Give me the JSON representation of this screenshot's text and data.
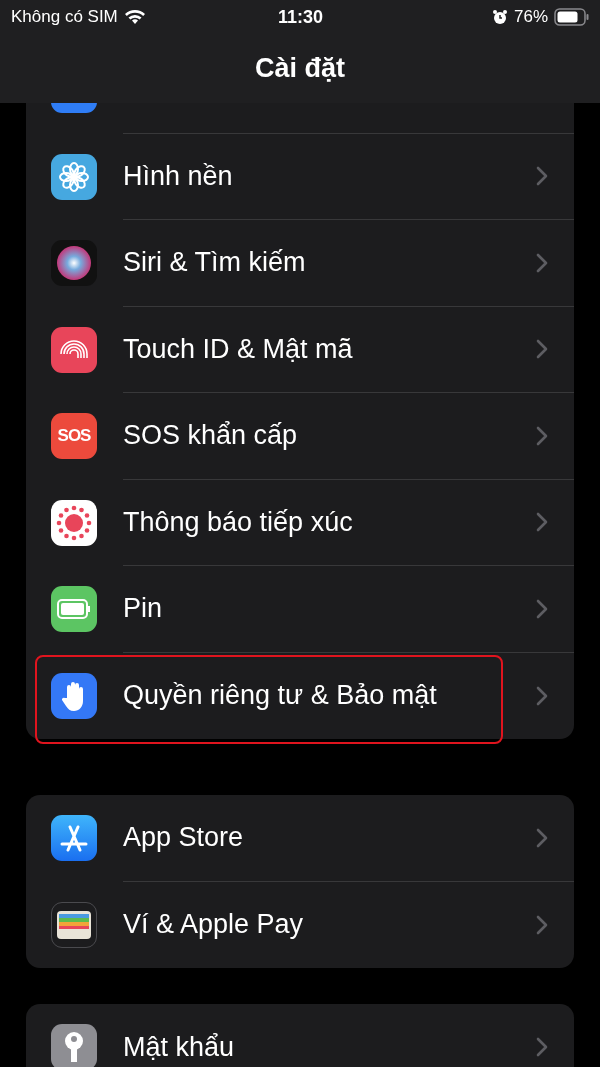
{
  "status_bar": {
    "carrier": "Không có SIM",
    "time": "11:30",
    "battery": "76%"
  },
  "title": "Cài đặt",
  "groups": [
    {
      "rows": [
        {
          "kind": "accessibility",
          "highlighted": false
        },
        {
          "kind": "wallpaper",
          "label": "Hình nền",
          "highlighted": false
        },
        {
          "kind": "siri",
          "label": "Siri & Tìm kiếm",
          "highlighted": false
        },
        {
          "kind": "fingerprint",
          "label": "Touch ID & Mật mã",
          "highlighted": false
        },
        {
          "kind": "sos",
          "icon_text": "SOS",
          "label": "SOS khẩn cấp",
          "highlighted": false
        },
        {
          "kind": "exposure",
          "label": "Thông báo tiếp xúc",
          "highlighted": false
        },
        {
          "kind": "battery",
          "label": "Pin",
          "highlighted": false
        },
        {
          "kind": "hand",
          "label": "Quyền riêng tư & Bảo mật",
          "highlighted": true
        }
      ]
    },
    {
      "rows": [
        {
          "kind": "appstore",
          "label": "App Store",
          "highlighted": false
        },
        {
          "kind": "wallet",
          "label": "Ví & Apple Pay",
          "highlighted": false
        }
      ]
    },
    {
      "rows": [
        {
          "kind": "key",
          "label": "Mật khẩu",
          "highlighted": false
        }
      ]
    }
  ]
}
